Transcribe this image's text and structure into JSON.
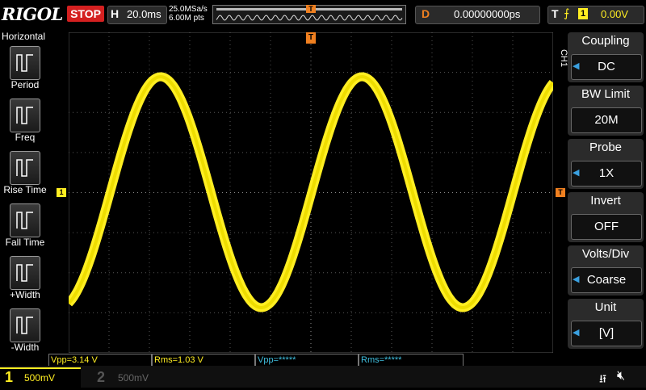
{
  "topbar": {
    "logo": "RIGOL",
    "run_state": "STOP",
    "h_letter": "H",
    "timebase": "20.0ms",
    "sample_rate": "25.0MSa/s",
    "memory_depth": "6.00M pts",
    "d_letter": "D",
    "delay": "0.00000000ps",
    "t_letter": "T",
    "trigger_source": "1",
    "trigger_level": "0.00V",
    "trigger_pos_marker": "T"
  },
  "left_menu": {
    "title": "Horizontal",
    "items": [
      {
        "label": "Period",
        "icon": "period-icon"
      },
      {
        "label": "Freq",
        "icon": "freq-icon"
      },
      {
        "label": "Rise Time",
        "icon": "rise-time-icon"
      },
      {
        "label": "Fall Time",
        "icon": "fall-time-icon"
      },
      {
        "label": "+Width",
        "icon": "pos-width-icon"
      },
      {
        "label": "-Width",
        "icon": "neg-width-icon"
      }
    ]
  },
  "right_menu": {
    "channel_tag": "CH1",
    "items": [
      {
        "title": "Coupling",
        "value": "DC"
      },
      {
        "title": "BW Limit",
        "value": "20M"
      },
      {
        "title": "Probe",
        "value": "1X"
      },
      {
        "title": "Invert",
        "value": "OFF"
      },
      {
        "title": "Volts/Div",
        "value": "Coarse"
      },
      {
        "title": "Unit",
        "value": "[V]"
      }
    ]
  },
  "markers": {
    "ch1_ground": "1",
    "trig_level": "T",
    "trig_pos": "T"
  },
  "measurements": [
    {
      "text": "Vpp=3.14 V",
      "color": "#ffee22"
    },
    {
      "text": "Rms=1.03 V",
      "color": "#ffee22"
    },
    {
      "text": "Vpp=*****",
      "color": "#40c0e0"
    },
    {
      "text": "Rms=*****",
      "color": "#40c0e0"
    }
  ],
  "bottom": {
    "ch1_num": "1",
    "ch1_scale": "500mV",
    "ch2_num": "2",
    "ch2_scale": "500mV"
  },
  "colors": {
    "ch1": "#ffee22",
    "trigger": "#f08020",
    "stop": "#d42020"
  }
}
